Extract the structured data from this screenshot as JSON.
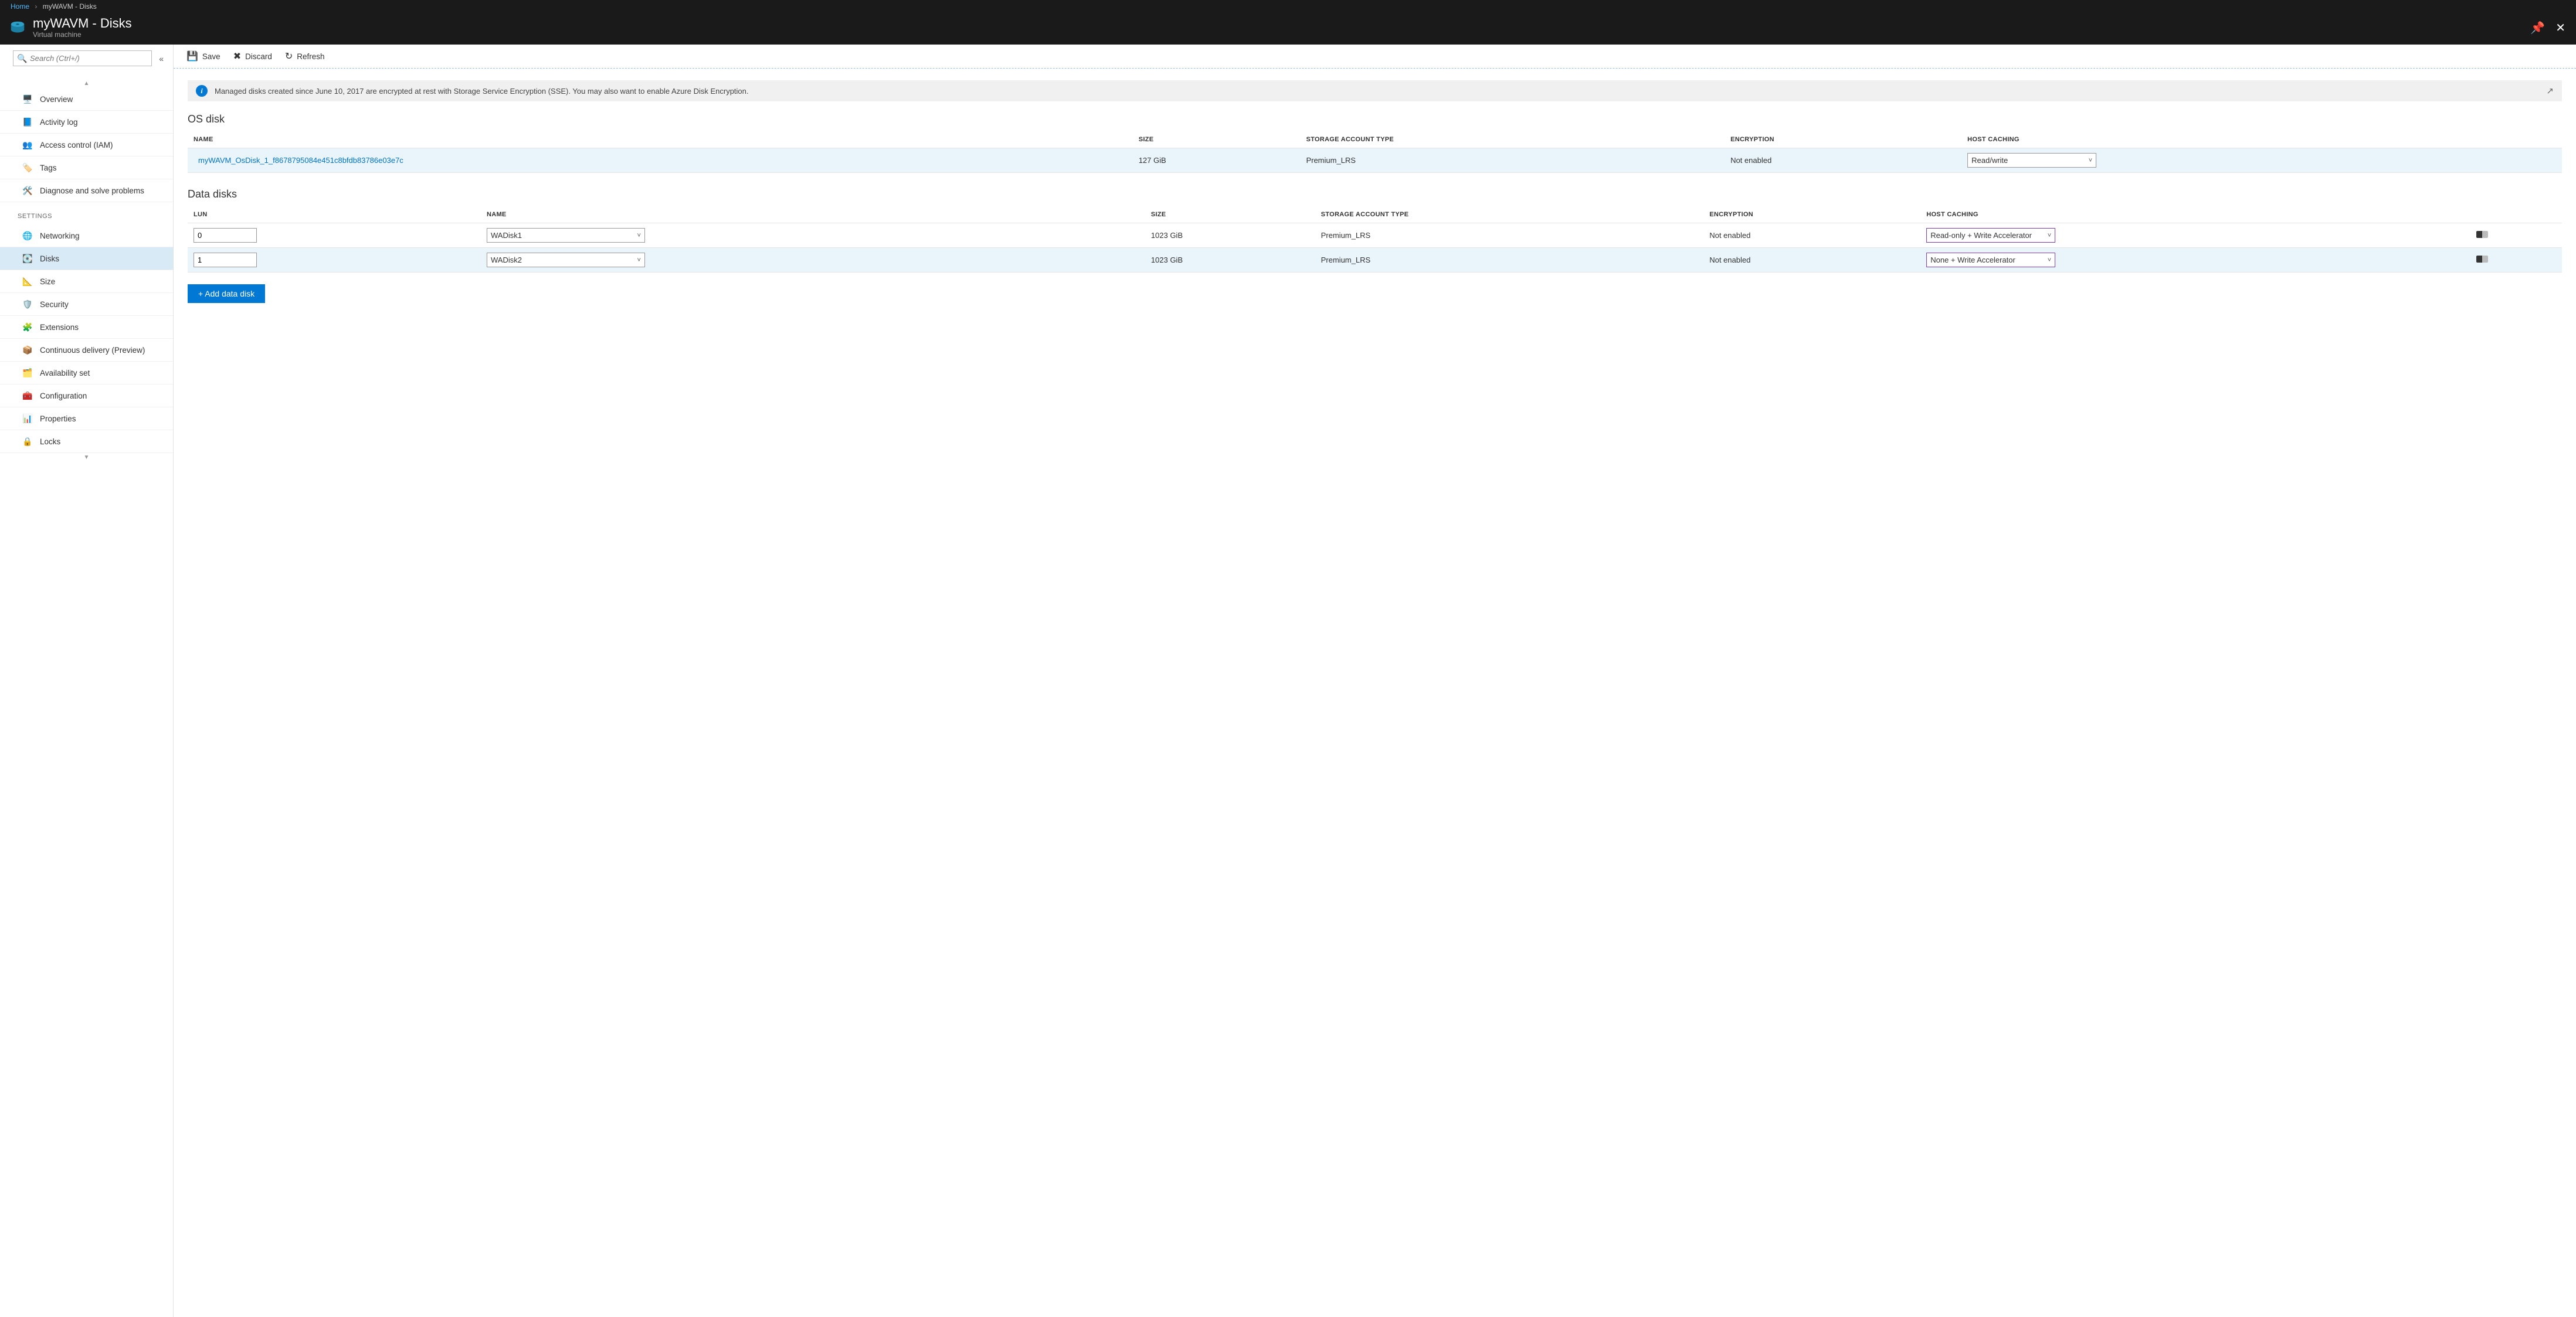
{
  "breadcrumb": {
    "home": "Home",
    "current": "myWAVM - Disks"
  },
  "title": {
    "main": "myWAVM - Disks",
    "subtitle": "Virtual machine"
  },
  "search": {
    "placeholder": "Search (Ctrl+/)"
  },
  "menu": {
    "primary": [
      {
        "label": "Overview",
        "icon": "monitor"
      },
      {
        "label": "Activity log",
        "icon": "log"
      },
      {
        "label": "Access control (IAM)",
        "icon": "iam"
      },
      {
        "label": "Tags",
        "icon": "tag"
      },
      {
        "label": "Diagnose and solve problems",
        "icon": "wrench"
      }
    ],
    "settings_header": "SETTINGS",
    "settings": [
      {
        "label": "Networking",
        "icon": "network"
      },
      {
        "label": "Disks",
        "icon": "disk",
        "selected": true
      },
      {
        "label": "Size",
        "icon": "size"
      },
      {
        "label": "Security",
        "icon": "shield"
      },
      {
        "label": "Extensions",
        "icon": "ext"
      },
      {
        "label": "Continuous delivery (Preview)",
        "icon": "cd"
      },
      {
        "label": "Availability set",
        "icon": "avail"
      },
      {
        "label": "Configuration",
        "icon": "config"
      },
      {
        "label": "Properties",
        "icon": "props"
      },
      {
        "label": "Locks",
        "icon": "lock"
      }
    ]
  },
  "toolbar": {
    "save": "Save",
    "discard": "Discard",
    "refresh": "Refresh"
  },
  "banner": {
    "message": "Managed disks created since June 10, 2017 are encrypted at rest with Storage Service Encryption (SSE). You may also want to enable Azure Disk Encryption."
  },
  "os_disk": {
    "heading": "OS disk",
    "cols": {
      "name": "NAME",
      "size": "SIZE",
      "storage": "STORAGE ACCOUNT TYPE",
      "encryption": "ENCRYPTION",
      "caching": "HOST CACHING"
    },
    "row": {
      "name": "myWAVM_OsDisk_1_f8678795084e451c8bfdb83786e03e7c",
      "size": "127 GiB",
      "storage": "Premium_LRS",
      "encryption": "Not enabled",
      "caching": "Read/write"
    }
  },
  "data_disks": {
    "heading": "Data disks",
    "cols": {
      "lun": "LUN",
      "name": "NAME",
      "size": "SIZE",
      "storage": "STORAGE ACCOUNT TYPE",
      "encryption": "ENCRYPTION",
      "caching": "HOST CACHING"
    },
    "rows": [
      {
        "lun": "0",
        "name": "WADisk1",
        "size": "1023 GiB",
        "storage": "Premium_LRS",
        "encryption": "Not enabled",
        "caching": "Read-only + Write Accelerator"
      },
      {
        "lun": "1",
        "name": "WADisk2",
        "size": "1023 GiB",
        "storage": "Premium_LRS",
        "encryption": "Not enabled",
        "caching": "None + Write Accelerator"
      }
    ],
    "add_button": "+ Add data disk"
  }
}
